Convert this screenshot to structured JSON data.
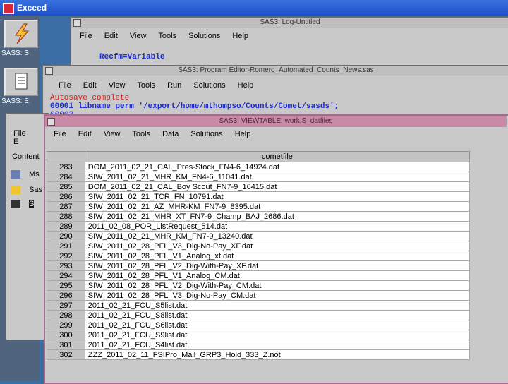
{
  "exceed": {
    "title": "Exceed"
  },
  "toolbox": {
    "items": [
      {
        "label": "SASS: S"
      },
      {
        "label": "SASS: E"
      }
    ]
  },
  "log_window": {
    "title": "SAS3: Log-Untitled",
    "menu": [
      "File",
      "Edit",
      "View",
      "Tools",
      "Solutions",
      "Help"
    ],
    "text": "Recfm=Variable"
  },
  "program_editor": {
    "title": "SAS3: Program Editor-Romero_Automated_Counts_News.sas",
    "menu": [
      "File",
      "Edit",
      "View",
      "Tools",
      "Run",
      "Solutions",
      "Help"
    ],
    "lines": [
      "Autosave complete",
      "00001 libname perm '/export/home/mthompso/Counts/Comet/sasds';",
      "00002"
    ]
  },
  "explorer": {
    "menu": [
      "File",
      "E"
    ],
    "heading": "Content",
    "items": [
      "Ms",
      "Sas",
      "S"
    ]
  },
  "viewtable": {
    "title": "SAS3: VIEWTABLE: work.S_datfiles",
    "menu": [
      "File",
      "Edit",
      "View",
      "Tools",
      "Data",
      "Solutions",
      "Help"
    ],
    "column_header": "cometfile",
    "rows": [
      {
        "n": "283",
        "v": "DOM_2011_02_21_CAL_Pres-Stock_FN4-6_14924.dat"
      },
      {
        "n": "284",
        "v": "SIW_2011_02_21_MHR_KM_FN4-6_11041.dat"
      },
      {
        "n": "285",
        "v": "DOM_2011_02_21_CAL_Boy Scout_FN7-9_16415.dat"
      },
      {
        "n": "286",
        "v": "SIW_2011_02_21_TCR_FN_10791.dat"
      },
      {
        "n": "287",
        "v": "SIW_2011_02_21_AZ_MHR-KM_FN7-9_8395.dat"
      },
      {
        "n": "288",
        "v": "SIW_2011_02_21_MHR_XT_FN7-9_Champ_BAJ_2686.dat"
      },
      {
        "n": "289",
        "v": "2011_02_08_POR_ListRequest_514.dat"
      },
      {
        "n": "290",
        "v": "SIW_2011_02_21_MHR_KM_FN7-9_13240.dat"
      },
      {
        "n": "291",
        "v": "SIW_2011_02_28_PFL_V3_Dig-No-Pay_XF.dat"
      },
      {
        "n": "292",
        "v": "SIW_2011_02_28_PFL_V1_Analog_xf.dat"
      },
      {
        "n": "293",
        "v": "SIW_2011_02_28_PFL_V2_Dig-With-Pay_XF.dat"
      },
      {
        "n": "294",
        "v": "SIW_2011_02_28_PFL_V1_Analog_CM.dat"
      },
      {
        "n": "295",
        "v": "SIW_2011_02_28_PFL_V2_Dig-With-Pay_CM.dat"
      },
      {
        "n": "296",
        "v": "SIW_2011_02_28_PFL_V3_Dig-No-Pay_CM.dat"
      },
      {
        "n": "297",
        "v": "2011_02_21_FCU_S5list.dat"
      },
      {
        "n": "298",
        "v": "2011_02_21_FCU_S8list.dat"
      },
      {
        "n": "299",
        "v": "2011_02_21_FCU_S6list.dat"
      },
      {
        "n": "300",
        "v": "2011_02_21_FCU_S9list.dat"
      },
      {
        "n": "301",
        "v": "2011_02_21_FCU_S4list.dat"
      },
      {
        "n": "302",
        "v": "ZZZ_2011_02_11_FSIPro_Mail_GRP3_Hold_333_Z.not"
      }
    ]
  }
}
